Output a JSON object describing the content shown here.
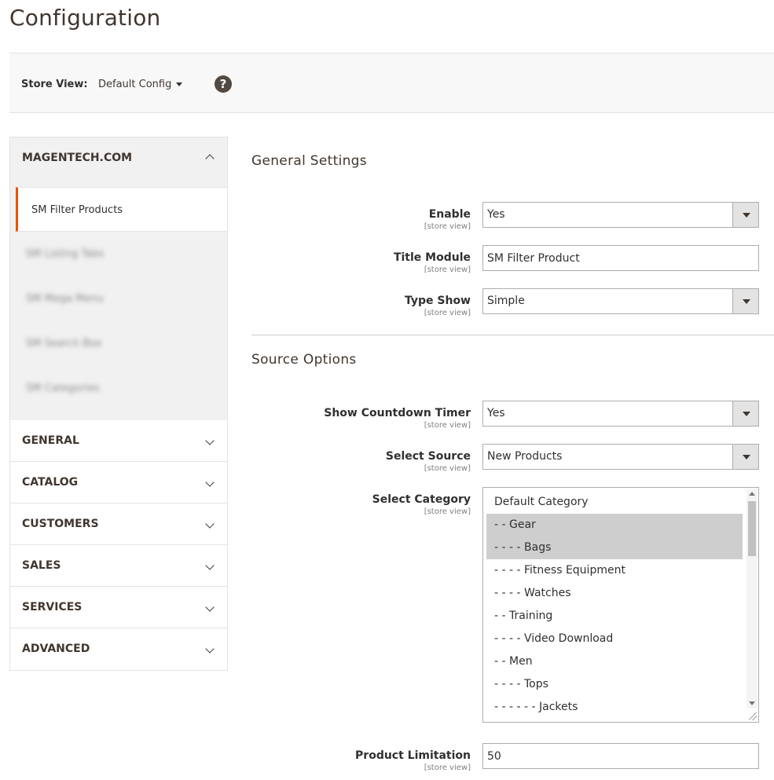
{
  "page": {
    "title": "Configuration"
  },
  "store_bar": {
    "label": "Store View:",
    "selected": "Default Config",
    "help": "?"
  },
  "sidebar": {
    "open_tab": {
      "label": "MAGENTECH.COM",
      "items": [
        {
          "label": "SM Filter Products",
          "active": true
        },
        {
          "label": "SM Listing Tabs",
          "blurred": true
        },
        {
          "label": "SM Mega Menu",
          "blurred": true
        },
        {
          "label": "SM Search Box",
          "blurred": true
        },
        {
          "label": "SM Categories",
          "blurred": true
        }
      ]
    },
    "tabs": [
      {
        "label": "GENERAL"
      },
      {
        "label": "CATALOG"
      },
      {
        "label": "CUSTOMERS"
      },
      {
        "label": "SALES"
      },
      {
        "label": "SERVICES"
      },
      {
        "label": "ADVANCED"
      }
    ]
  },
  "general_settings": {
    "title": "General Settings",
    "enable": {
      "label": "Enable",
      "scope": "[store view]",
      "value": "Yes"
    },
    "title_module": {
      "label": "Title Module",
      "scope": "[store view]",
      "value": "SM Filter Product"
    },
    "type_show": {
      "label": "Type Show",
      "scope": "[store view]",
      "value": "Simple"
    }
  },
  "source_options": {
    "title": "Source Options",
    "countdown": {
      "label": "Show Countdown Timer",
      "scope": "[store view]",
      "value": "Yes"
    },
    "select_source": {
      "label": "Select Source",
      "scope": "[store view]",
      "value": "New Products"
    },
    "select_category": {
      "label": "Select Category",
      "scope": "[store view]",
      "options": [
        {
          "label": "Default Category",
          "selected": false
        },
        {
          "label": "- - Gear",
          "selected": true
        },
        {
          "label": "- - - - Bags",
          "selected": true
        },
        {
          "label": "- - - - Fitness Equipment",
          "selected": false
        },
        {
          "label": "- - - - Watches",
          "selected": false
        },
        {
          "label": "- - Training",
          "selected": false
        },
        {
          "label": "- - - - Video Download",
          "selected": false
        },
        {
          "label": "- - Men",
          "selected": false
        },
        {
          "label": "- - - - Tops",
          "selected": false
        },
        {
          "label": "- - - - - - Jackets",
          "selected": false
        }
      ]
    },
    "product_limitation": {
      "label": "Product Limitation",
      "scope": "[store view]",
      "value": "50"
    }
  }
}
